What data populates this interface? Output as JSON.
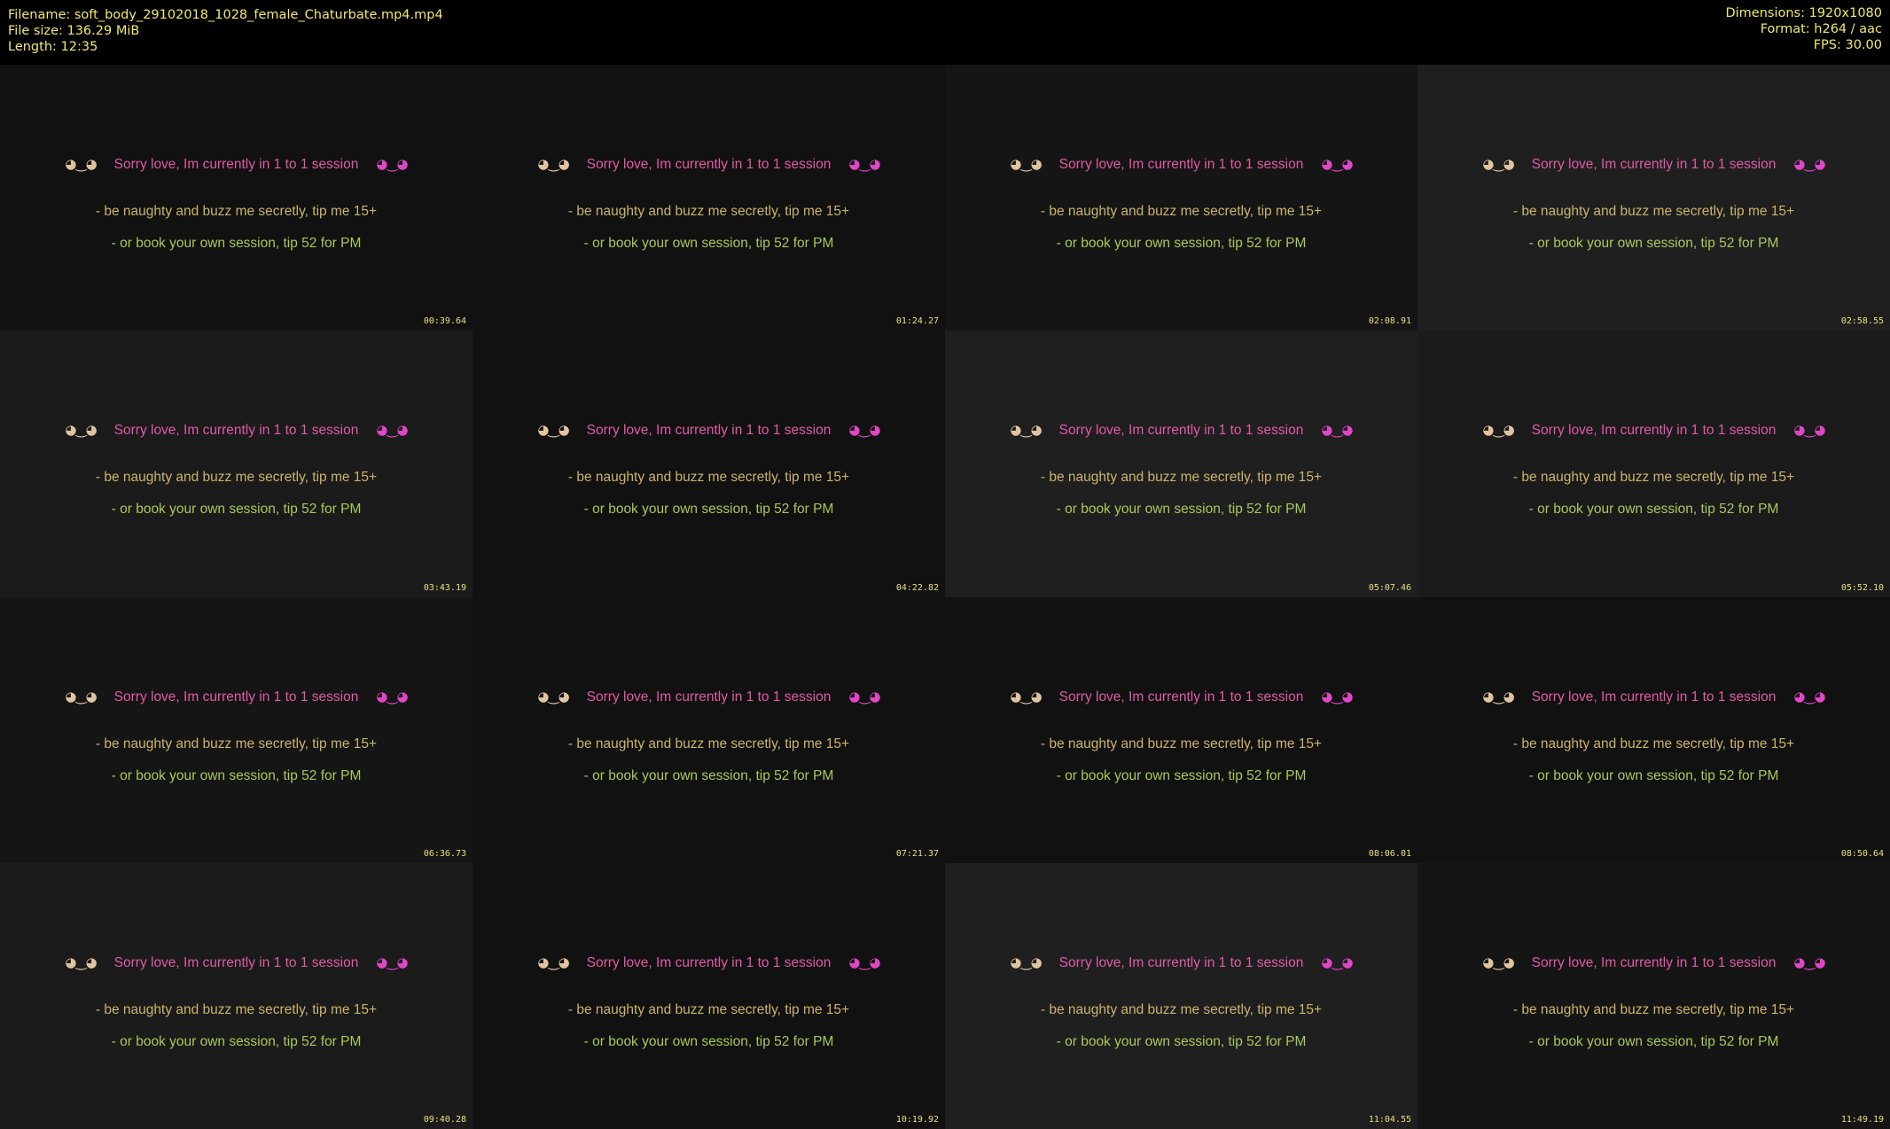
{
  "header": {
    "filename": "Filename: soft_body_29102018_1028_female_Chaturbate.mp4.mp4",
    "filesize": "File size: 136.29 MiB",
    "length": "Length: 12:35",
    "dimensions": "Dimensions: 1920x1080",
    "format": "Format: h264 / aac",
    "fps": "FPS: 30.00"
  },
  "overlay": {
    "face_left": "◕‿◕",
    "title": "Sorry love, Im currently in 1 to 1 session",
    "face_right": "◕‿◕",
    "naughty": "- be naughty and buzz me secretly, tip me 15+",
    "book": "- or book your own session, tip 52 for PM"
  },
  "thumbnails": [
    {
      "timestamp": "00:39.64"
    },
    {
      "timestamp": "01:24.27"
    },
    {
      "timestamp": "02:08.91"
    },
    {
      "timestamp": "02:58.55"
    },
    {
      "timestamp": "03:43.19"
    },
    {
      "timestamp": "04:22.82"
    },
    {
      "timestamp": "05:07.46"
    },
    {
      "timestamp": "05:52.10"
    },
    {
      "timestamp": "06:36.73"
    },
    {
      "timestamp": "07:21.37"
    },
    {
      "timestamp": "08:06.01"
    },
    {
      "timestamp": "08:50.64"
    },
    {
      "timestamp": "09:40.28"
    },
    {
      "timestamp": "10:19.92"
    },
    {
      "timestamp": "11:04.55"
    },
    {
      "timestamp": "11:49.19"
    }
  ],
  "colors": {
    "header_text": "#f2e96a",
    "title_pink": "#e05aa4",
    "naughty_tan": "#c9b46a",
    "book_green": "#a8c85a",
    "timestamp": "#e8e080"
  }
}
